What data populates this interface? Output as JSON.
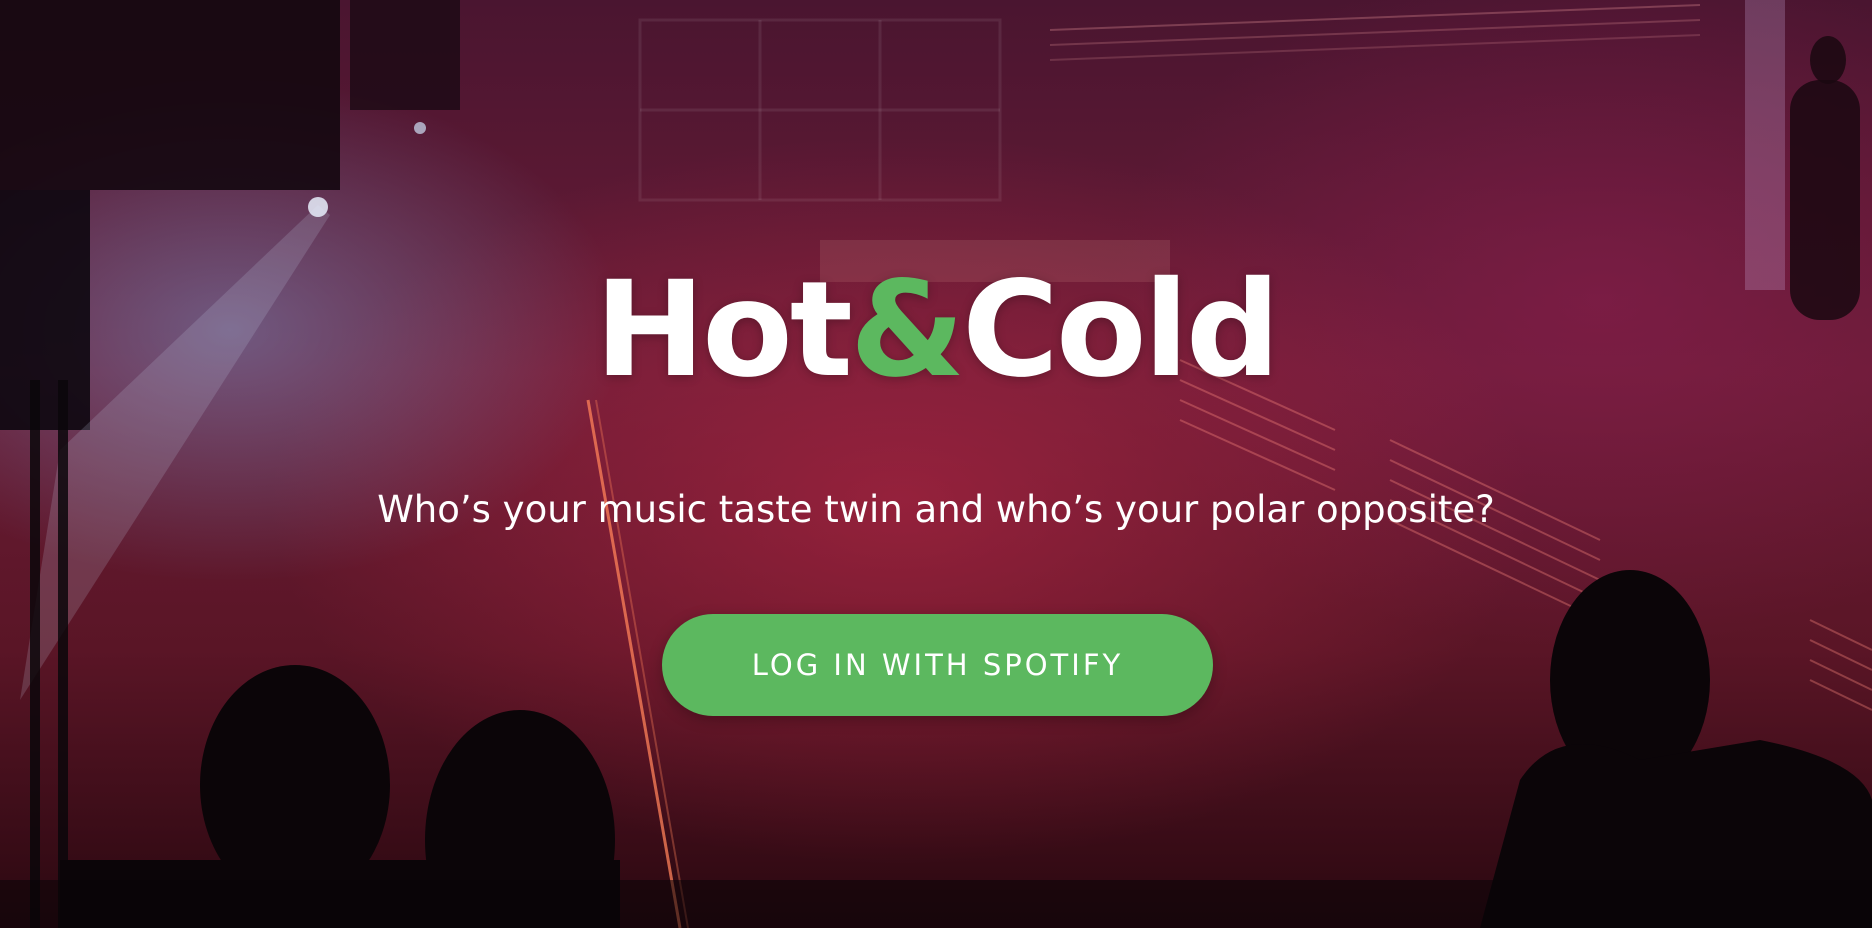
{
  "hero": {
    "logo_part_1": "Hot",
    "logo_ampersand": "&",
    "logo_part_2": "Cold",
    "subtitle": "Who’s your music taste twin and who’s your polar opposite?",
    "login_button_label": "LOG IN WITH SPOTIFY"
  },
  "colors": {
    "brand_green": "#5cb85f",
    "text": "#ffffff",
    "overlay": "#6a1c36"
  }
}
